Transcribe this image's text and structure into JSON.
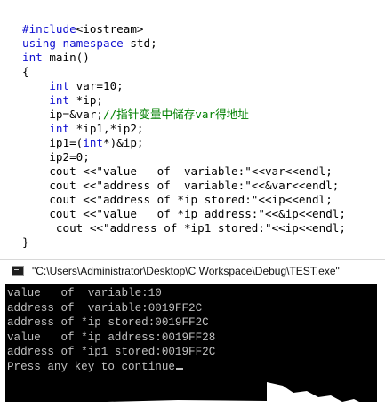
{
  "code": {
    "lines": [
      {
        "segments": [
          {
            "t": "#include",
            "c": "pp"
          },
          {
            "t": "<iostream>",
            "c": ""
          }
        ]
      },
      {
        "segments": [
          {
            "t": "using",
            "c": "kw"
          },
          {
            "t": " ",
            "c": ""
          },
          {
            "t": "namespace",
            "c": "kw"
          },
          {
            "t": " std;",
            "c": ""
          }
        ]
      },
      {
        "segments": [
          {
            "t": "int",
            "c": "kw"
          },
          {
            "t": " main()",
            "c": ""
          }
        ]
      },
      {
        "segments": [
          {
            "t": "{",
            "c": ""
          }
        ]
      },
      {
        "segments": [
          {
            "t": "    ",
            "c": ""
          },
          {
            "t": "int",
            "c": "kw"
          },
          {
            "t": " var=10;",
            "c": ""
          }
        ]
      },
      {
        "segments": [
          {
            "t": "    ",
            "c": ""
          },
          {
            "t": "int",
            "c": "kw"
          },
          {
            "t": " *ip;",
            "c": ""
          }
        ]
      },
      {
        "segments": [
          {
            "t": "    ip=&var;",
            "c": ""
          },
          {
            "t": "//指针变量中储存var得地址",
            "c": "cmt"
          }
        ]
      },
      {
        "segments": [
          {
            "t": "    ",
            "c": ""
          },
          {
            "t": "int",
            "c": "kw"
          },
          {
            "t": " *ip1,*ip2;",
            "c": ""
          }
        ]
      },
      {
        "segments": [
          {
            "t": "    ip1=(",
            "c": ""
          },
          {
            "t": "int",
            "c": "kw"
          },
          {
            "t": "*)&ip;",
            "c": ""
          }
        ]
      },
      {
        "segments": [
          {
            "t": "    ip2=0;",
            "c": ""
          }
        ]
      },
      {
        "segments": [
          {
            "t": "    cout <<\"value   of  variable:\"<<var<<endl;",
            "c": ""
          }
        ]
      },
      {
        "segments": [
          {
            "t": "    cout <<\"address of  variable:\"<<&var<<endl;",
            "c": ""
          }
        ]
      },
      {
        "segments": [
          {
            "t": "    cout <<\"address of *ip stored:\"<<ip<<endl;",
            "c": ""
          }
        ]
      },
      {
        "segments": [
          {
            "t": "    cout <<\"value   of *ip address:\"<<&ip<<endl;",
            "c": ""
          }
        ]
      },
      {
        "segments": [
          {
            "t": "     cout <<\"address of *ip1 stored:\"<<ip<<endl;",
            "c": ""
          }
        ]
      },
      {
        "segments": [
          {
            "t": "}",
            "c": ""
          }
        ]
      }
    ]
  },
  "console_window": {
    "title": "\"C:\\Users\\Administrator\\Desktop\\C Workspace\\Debug\\TEST.exe\"",
    "icon": "console-app-icon",
    "output_lines": [
      "value   of  variable:10",
      "address of  variable:0019FF2C",
      "address of *ip stored:0019FF2C",
      "value   of *ip address:0019FF28",
      "address of *ip1 stored:0019FF2C",
      "Press any key to continue"
    ]
  },
  "colors": {
    "keyword": "#1010d0",
    "comment": "#008000",
    "console_bg": "#000000",
    "console_fg": "#c0c0c0"
  }
}
